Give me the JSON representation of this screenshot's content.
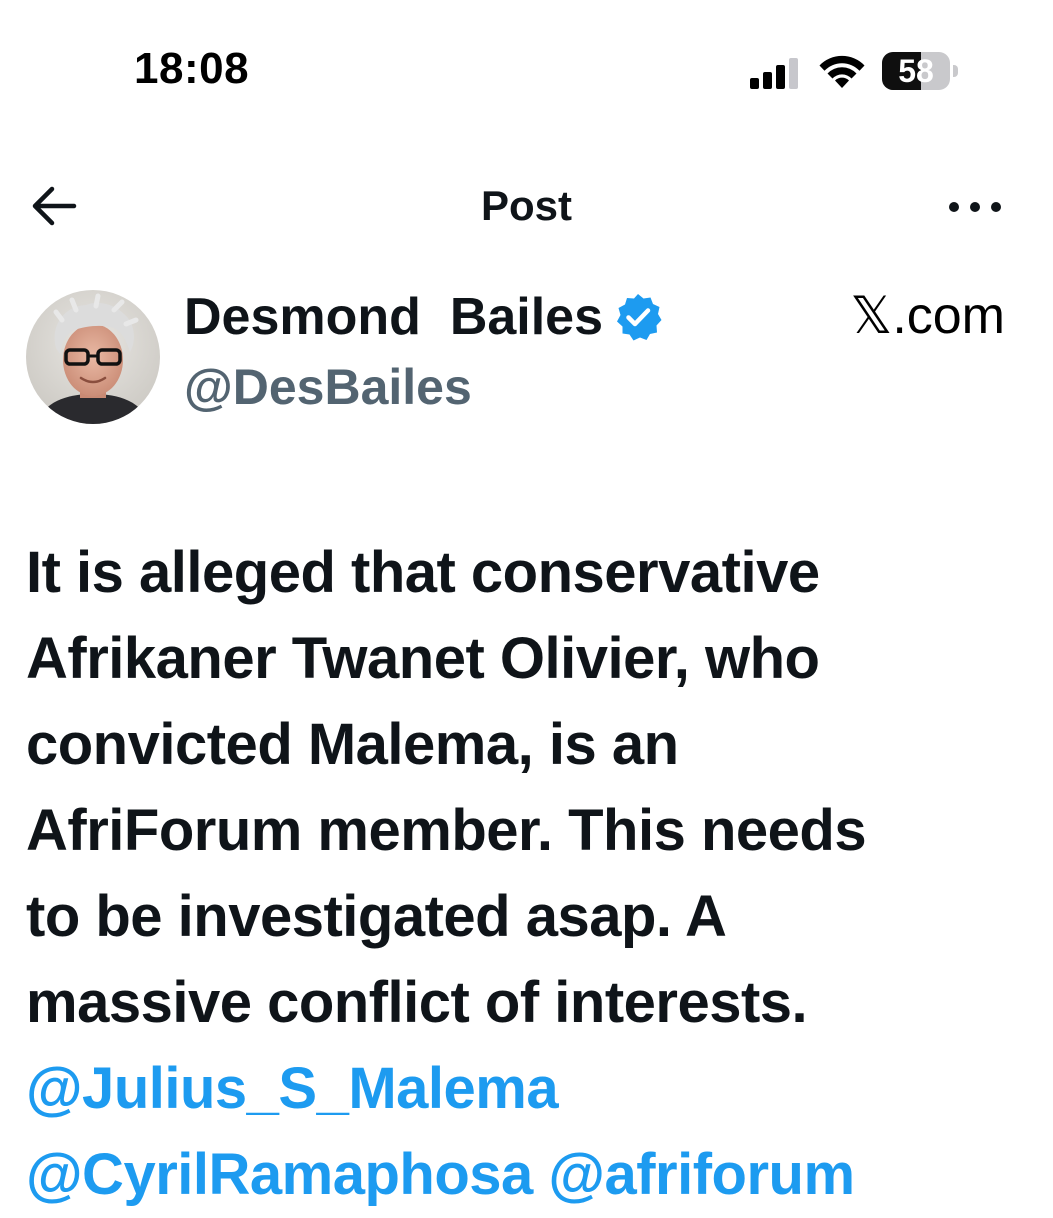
{
  "status_bar": {
    "time": "18:08",
    "battery_level": "58",
    "battery_fraction": 0.58,
    "signal_icon": "cellular-signal-icon",
    "wifi_icon": "wifi-icon",
    "battery_icon": "battery-icon"
  },
  "header": {
    "title": "Post",
    "back_icon": "arrow-left-icon",
    "more_icon": "more-horizontal-icon"
  },
  "author": {
    "display_name": "Desmond  Bailes",
    "handle": "@DesBailes",
    "verified": true,
    "verified_icon": "verified-badge-icon",
    "source_label": "𝕏.com"
  },
  "post": {
    "lines": [
      "It is alleged that conservative",
      "Afrikaner Twanet Olivier, who",
      "convicted Malema, is an",
      "AfriForum member. This needs",
      "to be investigated asap. A",
      "massive conflict of interests."
    ],
    "mentions": [
      "@Julius_S_Malema",
      "@CyrilRamaphosa",
      "@afriforum"
    ]
  },
  "colors": {
    "text": "#0f1419",
    "secondary_text": "#536471",
    "link": "#1d9bf0",
    "verified": "#1d9bf0",
    "background": "#ffffff"
  }
}
